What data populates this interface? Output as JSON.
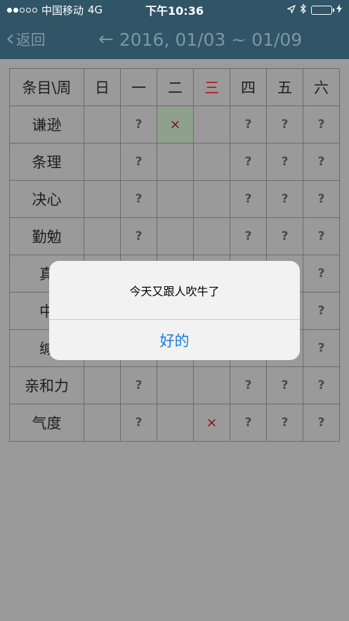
{
  "status": {
    "carrier": "中国移动",
    "network": "4G",
    "time": "下午10:36",
    "battery_color": "#4cd964"
  },
  "nav": {
    "back_label": "返回",
    "prev_arrow": "←",
    "title": "2016, 01/03 ~ 01/09"
  },
  "grid": {
    "header": [
      "条目\\周",
      "日",
      "一",
      "二",
      "三",
      "四",
      "五",
      "六"
    ],
    "rows": [
      {
        "label": "谦逊",
        "cells": [
          "",
          "?",
          "×",
          "",
          "?",
          "?",
          "?"
        ]
      },
      {
        "label": "条理",
        "cells": [
          "",
          "?",
          "",
          "",
          "?",
          "?",
          "?"
        ]
      },
      {
        "label": "决心",
        "cells": [
          "",
          "?",
          "",
          "",
          "?",
          "?",
          "?"
        ]
      },
      {
        "label": "勤勉",
        "cells": [
          "",
          "?",
          "",
          "",
          "?",
          "?",
          "?"
        ]
      },
      {
        "label": "真",
        "cells": [
          "",
          "",
          "",
          "",
          "",
          "",
          "?"
        ]
      },
      {
        "label": "中",
        "cells": [
          "",
          "",
          "",
          "",
          "",
          "",
          "?"
        ]
      },
      {
        "label": "缄",
        "cells": [
          "",
          "",
          "",
          "",
          "",
          "",
          "?"
        ]
      },
      {
        "label": "亲和力",
        "cells": [
          "",
          "?",
          "",
          "",
          "?",
          "?",
          "?"
        ]
      },
      {
        "label": "气度",
        "cells": [
          "",
          "?",
          "",
          "×",
          "?",
          "?",
          "?"
        ]
      }
    ]
  },
  "alert": {
    "message": "今天又跟人吹牛了",
    "button": "好的"
  }
}
